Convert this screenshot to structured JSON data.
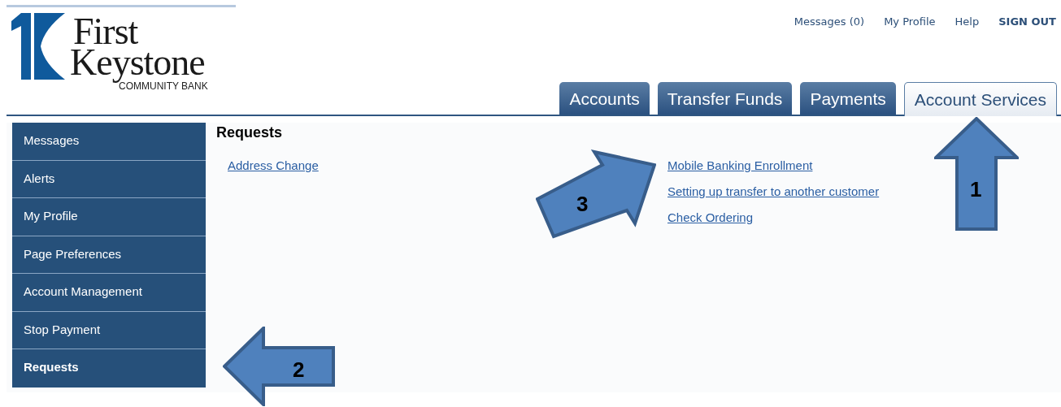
{
  "logo": {
    "line_1": "First",
    "line_2": "Keystone",
    "tagline": "COMMUNITY BANK"
  },
  "top_links": [
    {
      "label": "Messages (0)",
      "kind": "link"
    },
    {
      "label": "My Profile",
      "kind": "link"
    },
    {
      "label": "Help",
      "kind": "link"
    },
    {
      "label": "SIGN OUT",
      "kind": "strong"
    }
  ],
  "tabs": [
    {
      "label": "Accounts",
      "selected": false
    },
    {
      "label": "Transfer Funds",
      "selected": false
    },
    {
      "label": "Payments",
      "selected": false
    },
    {
      "label": "Account Services",
      "selected": true
    }
  ],
  "sidebar": {
    "items": [
      {
        "label": "Messages",
        "selected": false
      },
      {
        "label": "Alerts",
        "selected": false
      },
      {
        "label": "My Profile",
        "selected": false
      },
      {
        "label": "Page Preferences",
        "selected": false
      },
      {
        "label": "Account Management",
        "selected": false
      },
      {
        "label": "Stop Payment",
        "selected": false
      },
      {
        "label": "Requests",
        "selected": true
      }
    ]
  },
  "main": {
    "heading": "Requests",
    "left_links": [
      "Address Change"
    ],
    "right_links": [
      "Mobile Banking Enrollment",
      "Setting up transfer to another customer",
      "Check Ordering"
    ]
  },
  "callouts": [
    {
      "label": "1",
      "kind": "up"
    },
    {
      "label": "2",
      "kind": "left"
    },
    {
      "label": "3",
      "kind": "diagonal"
    }
  ]
}
